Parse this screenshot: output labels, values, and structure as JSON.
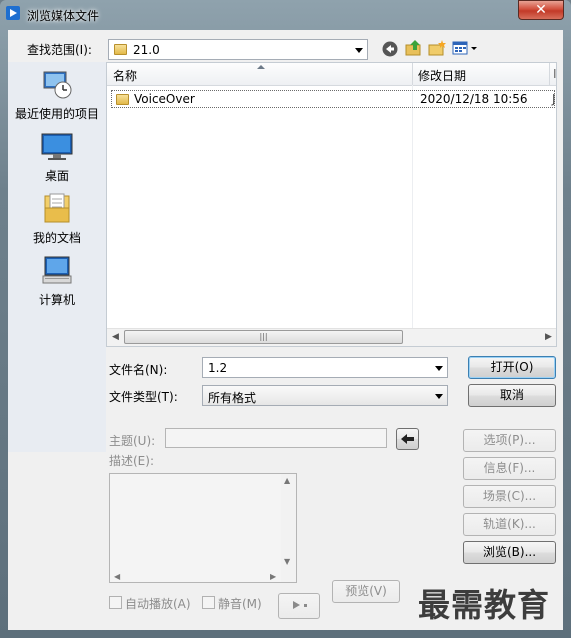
{
  "window": {
    "title": "浏览媒体文件",
    "close_label": "✕"
  },
  "lookin": {
    "label": "查找范围(I):",
    "value": "21.0"
  },
  "places": [
    {
      "label": "最近使用的项目",
      "icon": "recent-places-icon"
    },
    {
      "label": "桌面",
      "icon": "desktop-icon"
    },
    {
      "label": "我的文档",
      "icon": "documents-icon"
    },
    {
      "label": "计算机",
      "icon": "computer-icon"
    }
  ],
  "filelist": {
    "columns": [
      "名称",
      "修改日期",
      "I"
    ],
    "rows": [
      {
        "name": "VoiceOver",
        "modified": "2020/12/18 10:56",
        "extra": "J"
      }
    ],
    "scroll_grip": "|||"
  },
  "filename": {
    "label": "文件名(N):",
    "value": "1.2"
  },
  "filetype": {
    "label": "文件类型(T):",
    "value": "所有格式"
  },
  "buttons": {
    "open": "打开(O)",
    "cancel": "取消",
    "options": "选项(P)...",
    "info": "信息(F)...",
    "scene": "场景(C)...",
    "track": "轨道(K)...",
    "browse": "浏览(B)...",
    "preview": "预览(V)"
  },
  "meta": {
    "subject_label": "主题(U):",
    "desc_label": "描述(E):"
  },
  "checks": {
    "autoplay": "自动播放(A)",
    "mute": "静音(M)"
  },
  "watermark": "最需教育",
  "colors": {
    "titlebar": "#6e808c",
    "close": "#c23a28",
    "panel": "#f0f0f0"
  }
}
